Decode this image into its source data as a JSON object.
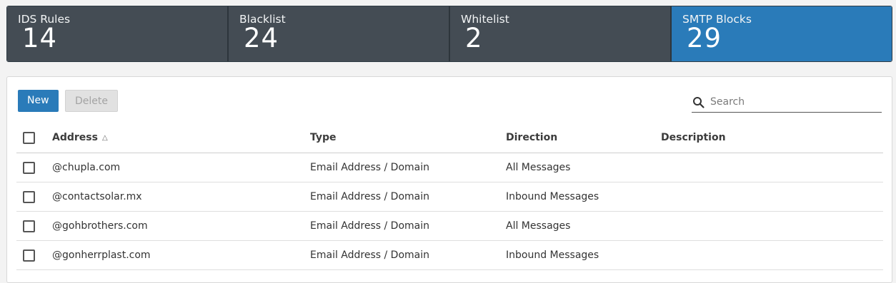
{
  "tiles": [
    {
      "label": "IDS Rules",
      "count": "14"
    },
    {
      "label": "Blacklist",
      "count": "24"
    },
    {
      "label": "Whitelist",
      "count": "2"
    },
    {
      "label": "SMTP Blocks",
      "count": "29"
    }
  ],
  "colors": {
    "active_tile": "#2a7bb9",
    "tile": "#444c54",
    "primary_button": "#2a7bb9"
  },
  "toolbar": {
    "new_label": "New",
    "delete_label": "Delete"
  },
  "search": {
    "placeholder": "Search",
    "value": ""
  },
  "table": {
    "headers": {
      "address": "Address",
      "type": "Type",
      "direction": "Direction",
      "description": "Description"
    },
    "sort": {
      "column": "address",
      "direction": "ascending",
      "icon": "sort-ascending-icon"
    },
    "rows": [
      {
        "address": "@chupla.com",
        "type": "Email Address / Domain",
        "direction": "All Messages",
        "description": ""
      },
      {
        "address": "@contactsolar.mx",
        "type": "Email Address / Domain",
        "direction": "Inbound Messages",
        "description": ""
      },
      {
        "address": "@gohbrothers.com",
        "type": "Email Address / Domain",
        "direction": "All Messages",
        "description": ""
      },
      {
        "address": "@gonherrplast.com",
        "type": "Email Address / Domain",
        "direction": "Inbound Messages",
        "description": ""
      }
    ]
  }
}
